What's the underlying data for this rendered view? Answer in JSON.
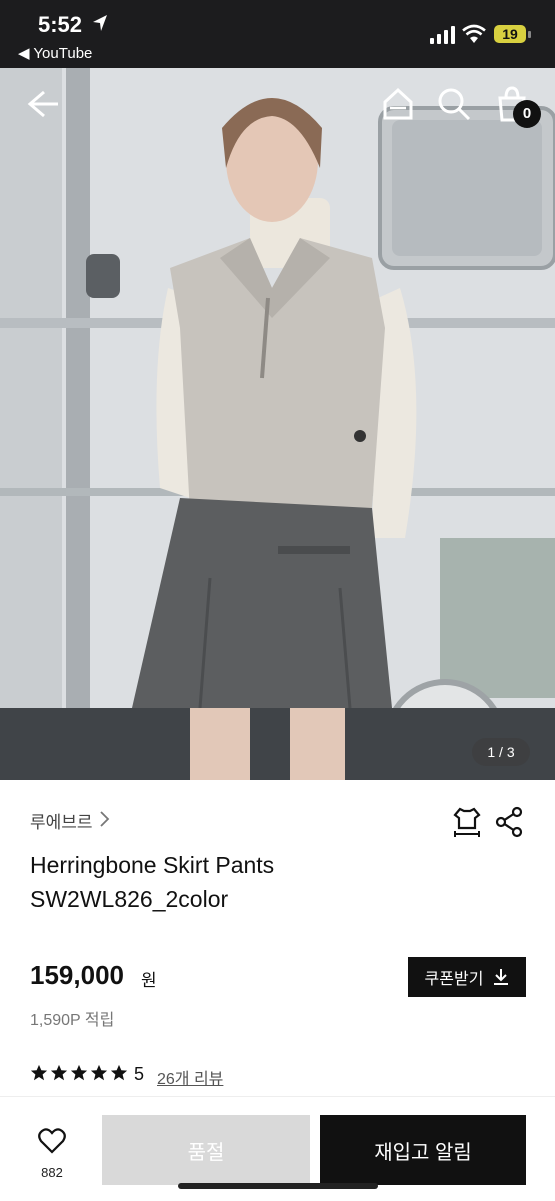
{
  "status_bar": {
    "time": "5:52",
    "back_app": "◀ YouTube",
    "battery": "19"
  },
  "hero": {
    "page_indicator": "1 / 3",
    "cart_count": "0"
  },
  "product": {
    "brand": "루에브르",
    "title": "Herringbone Skirt Pants SW2WL826_2color",
    "price": "159,000",
    "currency": "원",
    "points": "1,590P 적립",
    "rating": "5",
    "review_link": "26개 리뷰",
    "coupon_label": "쿠폰받기"
  },
  "bottom_bar": {
    "like_count": "882",
    "soldout_label": "품절",
    "restock_label": "재입고 알림"
  },
  "icons": [
    "back-icon",
    "home-icon",
    "search-icon",
    "cart-icon",
    "size-icon",
    "share-icon",
    "chevron-right-icon",
    "download-icon",
    "star-icon",
    "heart-icon"
  ]
}
